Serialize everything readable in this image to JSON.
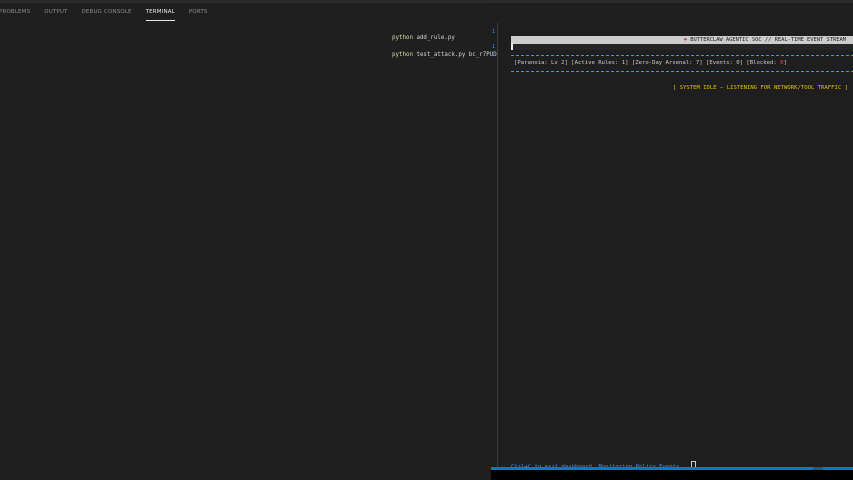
{
  "panel_tabs": [
    {
      "label": "PROBLEMS"
    },
    {
      "label": "OUTPUT"
    },
    {
      "label": "DEBUG CONSOLE"
    },
    {
      "label": "TERMINAL"
    },
    {
      "label": "PORTS"
    }
  ],
  "active_tab": "TERMINAL",
  "terminal": {
    "commands": [
      {
        "cmd": "python",
        "args": "add_rule.py"
      },
      {
        "cmd": "python",
        "args": "test_attack.py bc_r7PUD"
      }
    ],
    "markers": [
      "1",
      "1",
      "1"
    ]
  },
  "dashboard": {
    "header_icon": "❤",
    "header_title": "BUTTERCLAW AGENTIC SOC // REAL-TIME EVENT STREAM",
    "stats_prefix": "[Paranoia: Lv 2]  [Active Rules: 1]  [Zero-Day Arsenal: 7]  [Events: 0]  [Blocked: ",
    "stats_blocked": "0",
    "stats_suffix": "]",
    "idle_message": "[ SYSTEM IDLE — LISTENING FOR NETWORK/TOOL TRAFFIC ]",
    "footer": "Ctrl+C to exit dashboard. Monitoring Policy Events..."
  },
  "colors": {
    "accent_blue": "#3794ff",
    "warning_yellow": "#e5c000",
    "danger_red": "#f14c4c",
    "status_bar": "#007acc"
  }
}
